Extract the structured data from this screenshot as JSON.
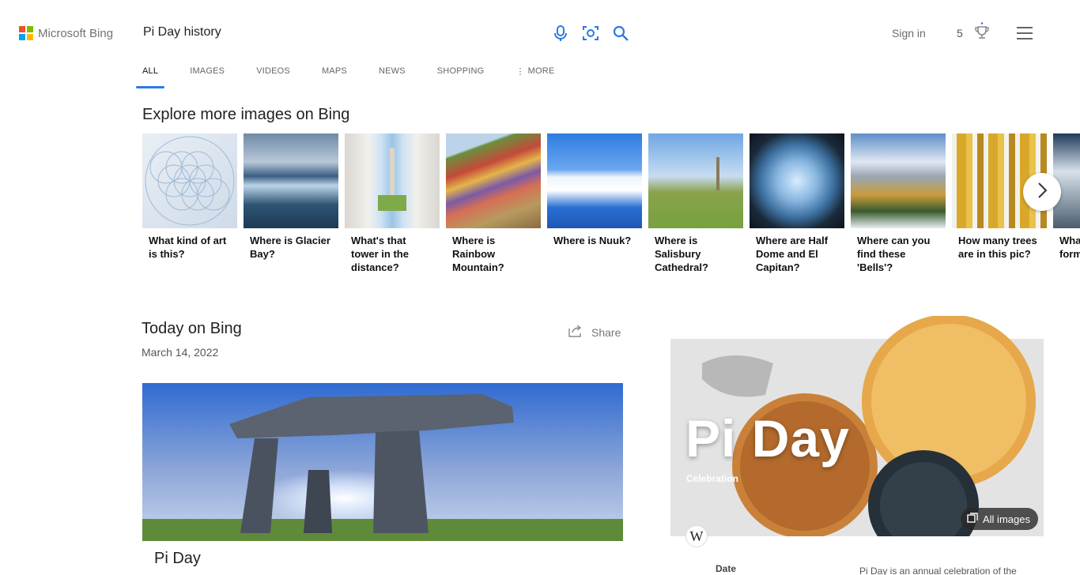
{
  "header": {
    "logo_text": "Microsoft Bing",
    "search_query": "Pi Day history",
    "sign_in": "Sign in",
    "rewards_count": "5",
    "icons": [
      "microphone-icon",
      "visual-search-icon",
      "search-icon",
      "rewards-trophy-icon",
      "hamburger-menu-icon"
    ],
    "accent_color": "#2a7ae2"
  },
  "tabs": [
    {
      "label": "ALL",
      "active": true
    },
    {
      "label": "IMAGES"
    },
    {
      "label": "VIDEOS"
    },
    {
      "label": "MAPS"
    },
    {
      "label": "NEWS"
    },
    {
      "label": "SHOPPING"
    },
    {
      "label": "MORE"
    }
  ],
  "explore": {
    "title": "Explore more images on Bing",
    "cards": [
      {
        "label": "What kind of art is this?"
      },
      {
        "label": "Where is Glacier Bay?"
      },
      {
        "label": "What's that tower in the distance?"
      },
      {
        "label": "Where is Rainbow Mountain?"
      },
      {
        "label": "Where is Nuuk?"
      },
      {
        "label": "Where is Salisbury Cathedral?"
      },
      {
        "label": "Where are Half Dome and El Capitan?"
      },
      {
        "label": "Where can you find these 'Bells'?"
      },
      {
        "label": "How many trees are in this pic?"
      },
      {
        "label": "What fantastic formation"
      }
    ]
  },
  "today": {
    "title": "Today on Bing",
    "date": "March 14, 2022",
    "share_label": "Share",
    "caption": "Pi Day"
  },
  "knowledge_card": {
    "title": "Pi Day",
    "subtitle": "Celebration",
    "all_images": "All images",
    "wiki_letter": "W",
    "date_label": "Date",
    "description": "Pi Day is an annual celebration of the"
  }
}
